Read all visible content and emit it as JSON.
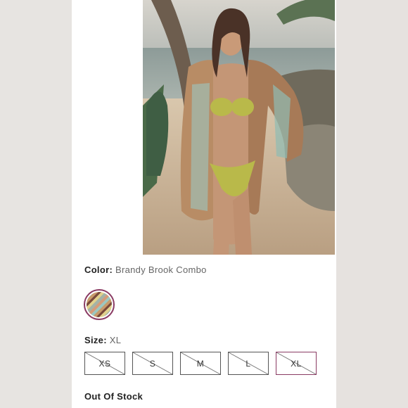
{
  "color": {
    "label": "Color:",
    "value": "Brandy Brook Combo"
  },
  "size": {
    "label": "Size:",
    "value": "XL",
    "options": [
      "XS",
      "S",
      "M",
      "L",
      "XL"
    ],
    "selected": "XL"
  },
  "stock_status": "Out Of Stock",
  "accent": "#8a3b63"
}
